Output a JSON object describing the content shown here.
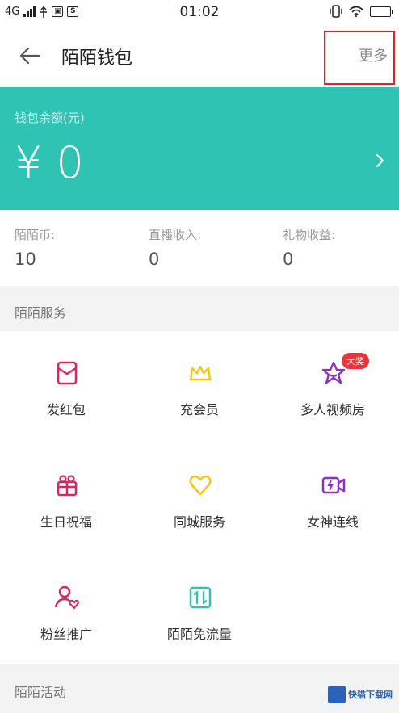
{
  "status_bar": {
    "network": "4G",
    "time": "01:02",
    "icons": [
      "signal-icon",
      "usb-icon",
      "notification-icon",
      "s-icon",
      "vibrate-icon",
      "wifi-icon",
      "battery-icon"
    ]
  },
  "header": {
    "title": "陌陌钱包",
    "more_label": "更多",
    "highlight_color": "#d8262b"
  },
  "balance": {
    "label": "钱包余额(元)",
    "value": "¥ 0",
    "background": "#2fc3b3"
  },
  "stats": [
    {
      "label": "陌陌币:",
      "value": "10"
    },
    {
      "label": "直播收入:",
      "value": "0"
    },
    {
      "label": "礼物收益:",
      "value": "0"
    }
  ],
  "services": {
    "title": "陌陌服务",
    "items": [
      {
        "label": "发红包",
        "icon": "red-packet-icon",
        "color": "#e0245e"
      },
      {
        "label": "充会员",
        "icon": "crown-icon",
        "color": "#f5c518"
      },
      {
        "label": "多人视频房",
        "icon": "star-face-icon",
        "color": "#8b2fc9",
        "badge": "大奖"
      },
      {
        "label": "生日祝福",
        "icon": "gift-icon",
        "color": "#e0245e"
      },
      {
        "label": "同城服务",
        "icon": "heart-icon",
        "color": "#f5c518"
      },
      {
        "label": "女神连线",
        "icon": "video-call-icon",
        "color": "#8b2fc9"
      },
      {
        "label": "粉丝推广",
        "icon": "user-heart-icon",
        "color": "#e0245e"
      },
      {
        "label": "陌陌免流量",
        "icon": "data-transfer-icon",
        "color": "#2fc3b3"
      }
    ]
  },
  "activities": {
    "title": "陌陌活动"
  },
  "watermark": {
    "text": "快猫下载网"
  }
}
